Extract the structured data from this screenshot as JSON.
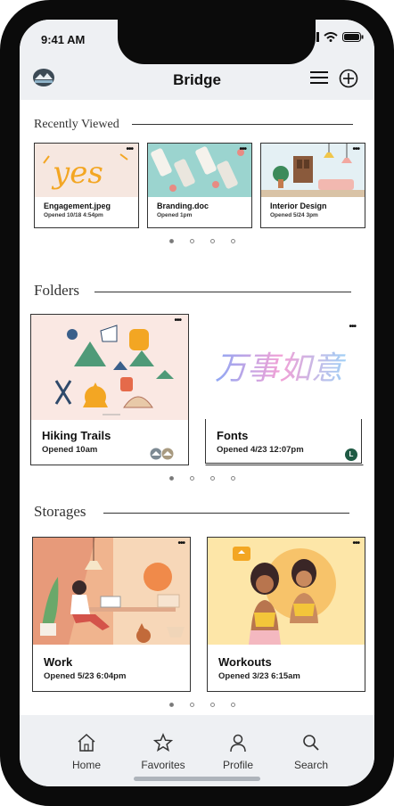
{
  "status": {
    "time": "9:41 AM"
  },
  "header": {
    "title": "Bridge"
  },
  "recently_viewed": {
    "title": "Recently Viewed",
    "items": [
      {
        "name": "Engagement.jpeg",
        "opened": "Opened 10/18 4:54pm"
      },
      {
        "name": "Branding.doc",
        "opened": "Opened 1pm"
      },
      {
        "name": "Interior Design",
        "opened": "Opened 5/24 3pm"
      }
    ],
    "thumb_texts": [
      "yes"
    ]
  },
  "folders": {
    "title": "Folders",
    "items": [
      {
        "name": "Hiking Trails",
        "opened": "Opened 10am"
      },
      {
        "name": "Fonts",
        "opened": "Opened 4/23 12:07pm",
        "avatar": "L"
      }
    ],
    "fonts_art_text": "万事如意"
  },
  "storages": {
    "title": "Storages",
    "items": [
      {
        "name": "Work",
        "opened": "Opened 5/23 6:04pm"
      },
      {
        "name": "Workouts",
        "opened": "Opened 3/23  6:15am"
      }
    ]
  },
  "more_glyph": "•••",
  "tabs": [
    {
      "label": "Home",
      "icon": "home-icon"
    },
    {
      "label": "Favorites",
      "icon": "star-icon"
    },
    {
      "label": "Profile",
      "icon": "person-icon"
    },
    {
      "label": "Search",
      "icon": "search-icon"
    }
  ]
}
